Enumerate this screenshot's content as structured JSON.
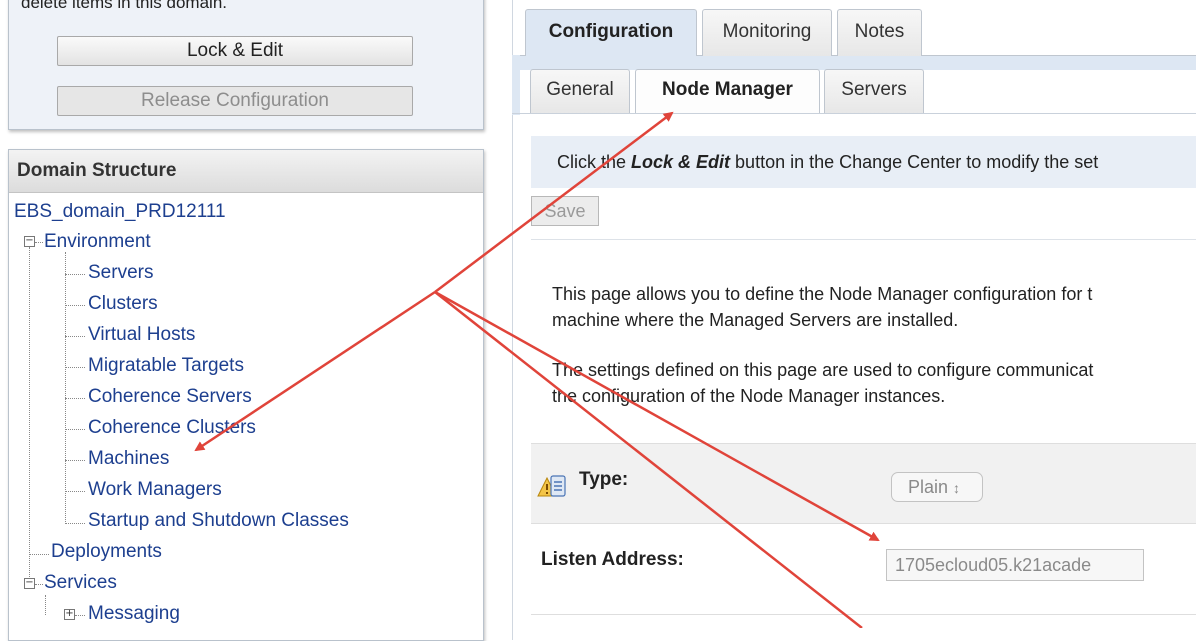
{
  "change_center": {
    "help_text": "delete items in this domain.",
    "lock_edit_label": "Lock & Edit",
    "release_label": "Release Configuration"
  },
  "domain_structure": {
    "title": "Domain Structure",
    "root": "EBS_domain_PRD12111",
    "environment": "Environment",
    "env_children": [
      "Servers",
      "Clusters",
      "Virtual Hosts",
      "Migratable Targets",
      "Coherence Servers",
      "Coherence Clusters",
      "Machines",
      "Work Managers",
      "Startup and Shutdown Classes"
    ],
    "deployments": "Deployments",
    "services": "Services",
    "messaging": "Messaging"
  },
  "tabs": {
    "primary": [
      "Configuration",
      "Monitoring",
      "Notes"
    ],
    "primary_active": "Configuration",
    "secondary": [
      "General",
      "Node Manager",
      "Servers"
    ],
    "secondary_active": "Node Manager"
  },
  "main": {
    "msg_before": "Click the ",
    "msg_bold": "Lock & Edit",
    "msg_after": " button in the Change Center to modify the set",
    "save_label": "Save",
    "desc1_line1": "This page allows you to define the Node Manager configuration for t",
    "desc1_line2": "machine where the Managed Servers are installed.",
    "desc2_line1": "The settings defined on this page are used to configure communicat",
    "desc2_line2": "the configuration of the Node Manager instances."
  },
  "form": {
    "type_label": "Type:",
    "type_value": "Plain",
    "type_arrow": "↕",
    "listen_label": "Listen Address:",
    "listen_value": "1705ecloud05.k21acade"
  },
  "colors": {
    "annotation_arrow": "#e0443a",
    "link": "#1d3f8f",
    "tab_active_bg": "#dde7f3"
  }
}
